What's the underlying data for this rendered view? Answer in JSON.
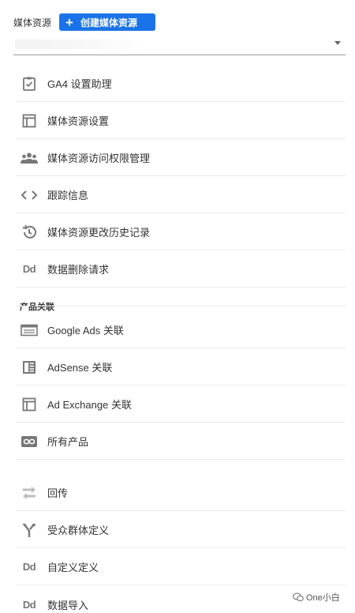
{
  "header": {
    "label": "媒体资源",
    "create_button": "创建媒体资源"
  },
  "menu": [
    {
      "label": "GA4 设置助理",
      "icon": "clipboard-check-icon"
    },
    {
      "label": "媒体资源设置",
      "icon": "layout-icon"
    },
    {
      "label": "媒体资源访问权限管理",
      "icon": "people-icon"
    },
    {
      "label": "跟踪信息",
      "icon": "code-icon"
    },
    {
      "label": "媒体资源更改历史记录",
      "icon": "history-icon"
    },
    {
      "label": "数据删除请求",
      "icon": "dd-icon",
      "icon_text": "Dd"
    }
  ],
  "product_links": {
    "title": "产品关联",
    "items": [
      {
        "label": "Google Ads 关联",
        "icon": "google-ads-icon"
      },
      {
        "label": "AdSense 关联",
        "icon": "adsense-icon"
      },
      {
        "label": "Ad Exchange 关联",
        "icon": "ad-exchange-icon"
      },
      {
        "label": "所有产品",
        "icon": "link-icon"
      }
    ]
  },
  "more": [
    {
      "label": "回传",
      "icon": "postback-icon"
    },
    {
      "label": "受众群体定义",
      "icon": "fork-icon"
    },
    {
      "label": "自定义定义",
      "icon": "dd-icon",
      "icon_text": "Dd"
    },
    {
      "label": "数据导入",
      "icon": "dd-icon",
      "icon_text": "Dd"
    }
  ],
  "watermark": "One小白",
  "colors": {
    "accent": "#1a73e8",
    "icon": "#777777",
    "divider": "#ececec"
  }
}
